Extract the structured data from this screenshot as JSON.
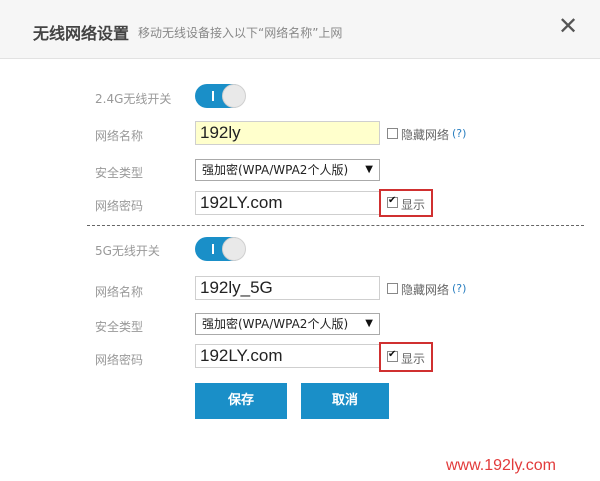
{
  "dialog": {
    "title": "无线网络设置",
    "subtitle": "移动无线设备接入以下“网络名称”上网",
    "close_glyph": "✕"
  },
  "band24": {
    "switch_label": "2.4G无线开关",
    "switch_on": true,
    "ssid_label": "网络名称",
    "ssid_value": "192ly",
    "hide_label": "隐藏网络",
    "hide_checked": false,
    "help": "(?)",
    "security_label": "安全类型",
    "security_value": "强加密(WPA/WPA2个人版)",
    "password_label": "网络密码",
    "password_value": "192LY.com",
    "show_label": "显示",
    "show_checked": true
  },
  "band5": {
    "switch_label": "5G无线开关",
    "switch_on": true,
    "ssid_label": "网络名称",
    "ssid_value": "192ly_5G",
    "hide_label": "隐藏网络",
    "hide_checked": false,
    "help": "(?)",
    "security_label": "安全类型",
    "security_value": "强加密(WPA/WPA2个人版)",
    "password_label": "网络密码",
    "password_value": "192LY.com",
    "show_label": "显示",
    "show_checked": true
  },
  "buttons": {
    "save": "保存",
    "cancel": "取消"
  },
  "watermark": "www.192ly.com",
  "colors": {
    "accent": "#1a8fc8",
    "highlight_box": "#d03030",
    "ssid_highlight": "#ffffcc"
  }
}
